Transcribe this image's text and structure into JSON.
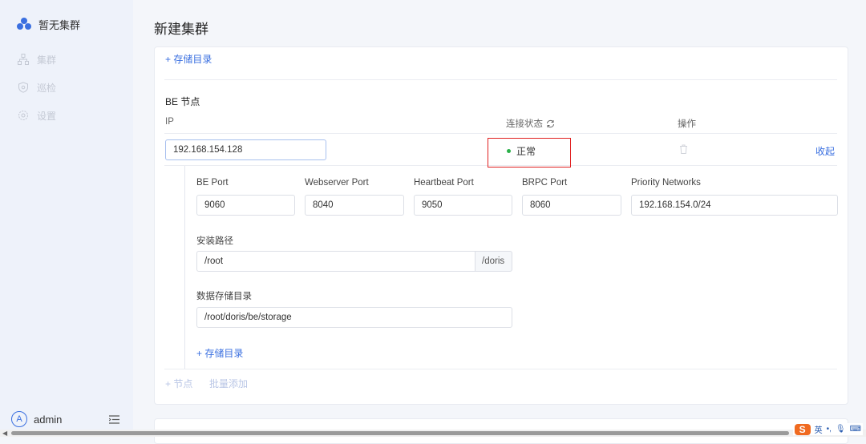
{
  "sidebar": {
    "brand": {
      "label": "暂无集群",
      "icon": "cluster-logo-icon"
    },
    "items": [
      {
        "label": "集群",
        "icon": "cluster-icon"
      },
      {
        "label": "巡检",
        "icon": "shield-icon"
      },
      {
        "label": "设置",
        "icon": "gear-icon"
      }
    ],
    "user": {
      "avatar": "A",
      "name": "admin"
    }
  },
  "page": {
    "title": "新建集群"
  },
  "top_add_storage": "+ 存储目录",
  "be": {
    "section_title": "BE 节点",
    "columns": {
      "ip": "IP",
      "status": "连接状态",
      "actions": "操作"
    },
    "row": {
      "ip": "192.168.154.128",
      "status": "正常",
      "collapse": "收起"
    },
    "ports": [
      {
        "label": "BE Port",
        "value": "9060"
      },
      {
        "label": "Webserver Port",
        "value": "8040"
      },
      {
        "label": "Heartbeat Port",
        "value": "9050"
      },
      {
        "label": "BRPC Port",
        "value": "8060"
      },
      {
        "label": "Priority Networks",
        "value": "192.168.154.0/24"
      }
    ],
    "install_path": {
      "label": "安装路径",
      "value": "/root",
      "suffix": "/doris"
    },
    "data_dir": {
      "label": "数据存储目录",
      "value": "/root/doris/be/storage"
    },
    "add_storage": "+ 存储目录",
    "add_node": "+ 节点",
    "batch_add": "批量添加"
  },
  "ime": {
    "lang": "英"
  },
  "colors": {
    "accent": "#3a6fe0",
    "status_ok": "#2bb04a",
    "highlight": "#e02020"
  }
}
